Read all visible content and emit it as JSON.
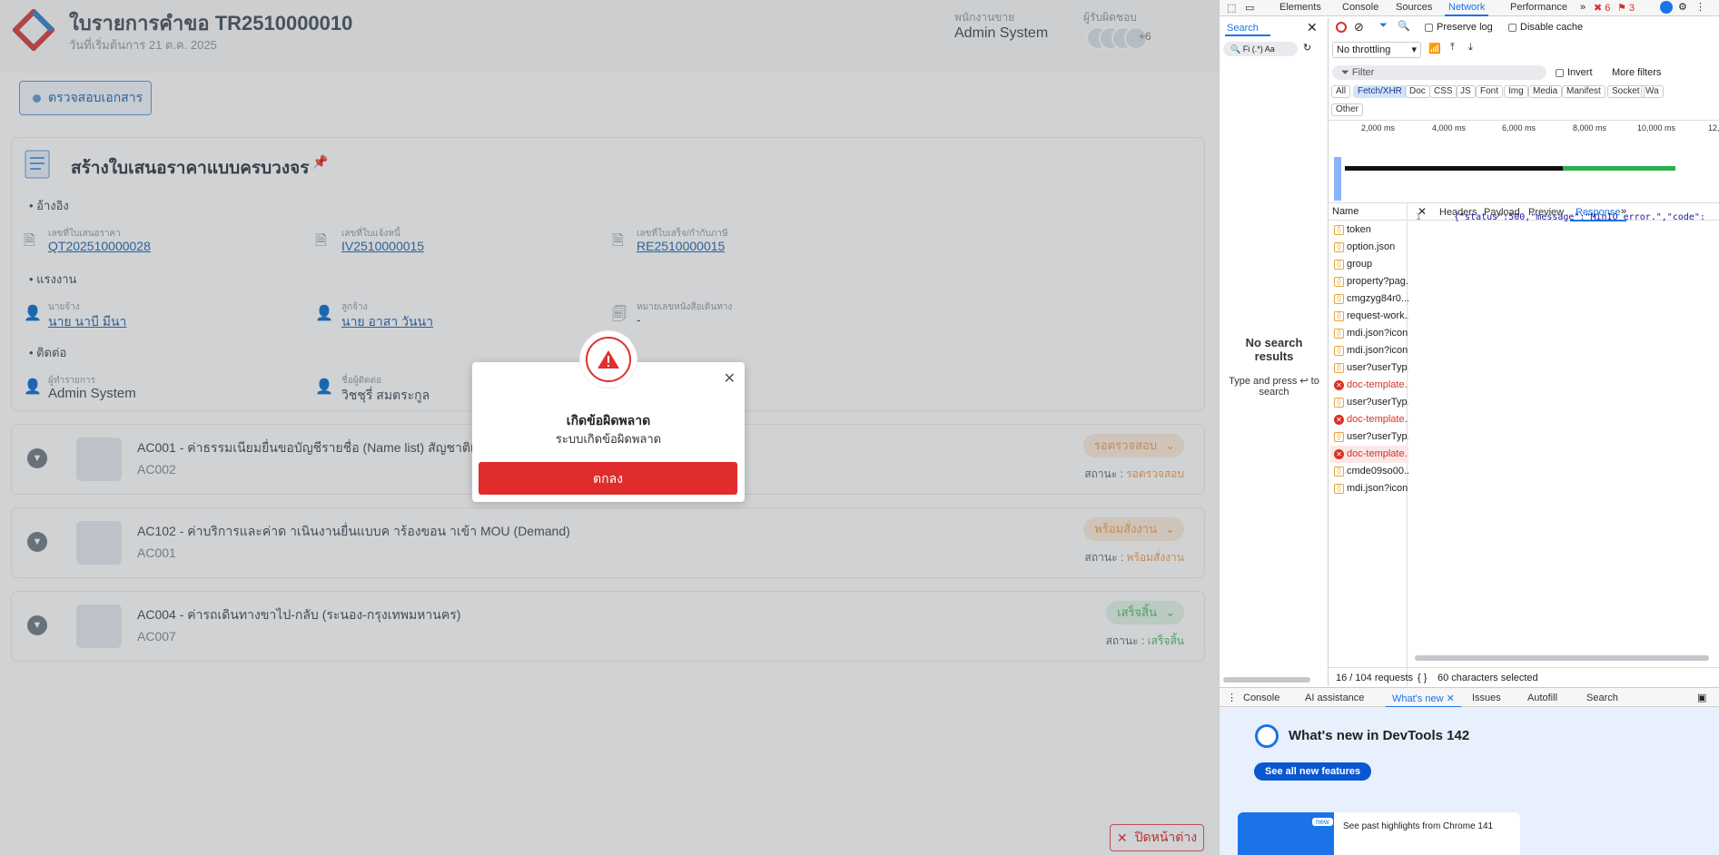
{
  "app": {
    "title": "ใบรายการคำขอ TR2510000010",
    "subtitle": "วันที่เริ่มต้นการ 21 ต.ค. 2025",
    "employee_label": "พนักงานขาย",
    "employee_value": "Admin System",
    "responsible_label": "ผู้รับผิดชอบ",
    "avatar_more": "+6",
    "check_doc_button": "ตรวจสอบเอกสาร",
    "panel_title": "สร้างใบเสนอราคาแบบครบวงจร",
    "sections": {
      "reference": "อ้างอิง",
      "employer": "แรงงาน",
      "contact": "ติดต่อ"
    },
    "fields": {
      "quotation_label": "เลขที่ใบเสนอราคา",
      "quotation_value": "QT202510000028",
      "invoice_label": "เลขที่ใบแจ้งหนี้",
      "invoice_value": "IV2510000015",
      "receipt_label": "เลขที่ใบเสร็จ/กำกับภาษี",
      "receipt_value": "RE2510000015",
      "employer_label": "นายจ้าง",
      "employer_value": "นาย นาบี มีนา",
      "customer_label": "ลูกจ้าง",
      "customer_value": "นาย อาสา วันนา",
      "passport_label": "หมายเลขหนังสือเดินทาง",
      "passport_value": "-",
      "agent_label": "ผู้ทำรายการ",
      "agent_value": "Admin System",
      "contact_label": "ชื่อผู้ติดต่อ",
      "contact_value": "วิชชุรี่ สมตระกูล"
    },
    "cards": [
      {
        "title": "AC001 - ค่าธรรมเนียมยื่นขอบัญชีรายชื่อ (Name list) สัญชาติเมียนมา",
        "code": "AC002",
        "status": "รอตรวจสอบ",
        "status_label": "สถานะ :",
        "status_value": "รอตรวจสอบ",
        "status_color": "#f2a65a"
      },
      {
        "title": "AC102 - ค่าบริการและค่าด าเนินงานยื่นแบบค าร้องขอน าเข้า MOU (Demand)",
        "code": "AC001",
        "status": "พร้อมสั่งงาน",
        "status_label": "สถานะ :",
        "status_value": "พร้อมสั่งงาน",
        "status_color": "#f2a65a"
      },
      {
        "title": "AC004 - ค่ารถเดินทางขาไป-กลับ (ระนอง-กรุงเทพมหานคร)",
        "code": "AC007",
        "status": "เสร็จสิ้น",
        "status_label": "สถานะ :",
        "status_value": "เสร็จสิ้น",
        "status_color": "#5cbf73"
      }
    ],
    "close_window": "ปิดหน้าต่าง"
  },
  "modal": {
    "title": "เกิดข้อผิดพลาด",
    "message": "ระบบเกิดข้อผิดพลาด",
    "ok_button": "ตกลง"
  },
  "devtools": {
    "tabs": [
      "Elements",
      "Console",
      "Sources",
      "Network",
      "Performance"
    ],
    "error_count": "6",
    "warning_count": "3",
    "search_tab": "Search",
    "search_placeholder": "Fi",
    "search_regex": "(.*)",
    "search_case": "Aa",
    "no_results_title": "No search results",
    "no_results_hint": "Type and press ↩ to search",
    "preserve_log": "Preserve log",
    "disable_cache": "Disable cache",
    "throttling": "No throttling",
    "filter_placeholder": "Filter",
    "invert": "Invert",
    "more_filters": "More filters",
    "filter_types": [
      "All",
      "Fetch/XHR",
      "Doc",
      "CSS",
      "JS",
      "Font",
      "Img",
      "Media",
      "Manifest",
      "Socket",
      "Wa",
      "Other"
    ],
    "timeline_ticks": [
      "2,000 ms",
      "4,000 ms",
      "6,000 ms",
      "8,000 ms",
      "10,000 ms",
      "12,"
    ],
    "name_header": "Name",
    "requests": [
      {
        "name": "token",
        "error": false
      },
      {
        "name": "option.json",
        "error": false
      },
      {
        "name": "group",
        "error": false
      },
      {
        "name": "property?pag...",
        "error": false
      },
      {
        "name": "cmgzyg84r0...",
        "error": false
      },
      {
        "name": "request-work...",
        "error": false
      },
      {
        "name": "mdi.json?icon...",
        "error": false
      },
      {
        "name": "mdi.json?icon...",
        "error": false
      },
      {
        "name": "user?userTyp...",
        "error": false
      },
      {
        "name": "doc-template...",
        "error": true
      },
      {
        "name": "user?userTyp...",
        "error": false
      },
      {
        "name": "doc-template...",
        "error": true
      },
      {
        "name": "user?userTyp...",
        "error": false
      },
      {
        "name": "doc-template...",
        "error": true
      },
      {
        "name": "cmde09so00...",
        "error": false
      },
      {
        "name": "mdi.json?icon...",
        "error": false
      }
    ],
    "detail_tabs": [
      "Headers",
      "Payload",
      "Preview",
      "Response"
    ],
    "response_line_no": "1",
    "response_text": "{\"status\":500,\"message\":\"MinIO error.\",\"code\":",
    "requests_count": "16 / 104 requests",
    "selected_chars": "60 characters selected",
    "drawer_tabs": [
      "Console",
      "AI assistance",
      "What's new",
      "Issues",
      "Autofill",
      "Search"
    ],
    "whats_new_title": "What's new in DevTools 142",
    "see_all": "See all new features",
    "badge_new": "new",
    "past_highlights": "See past highlights from Chrome 141"
  }
}
